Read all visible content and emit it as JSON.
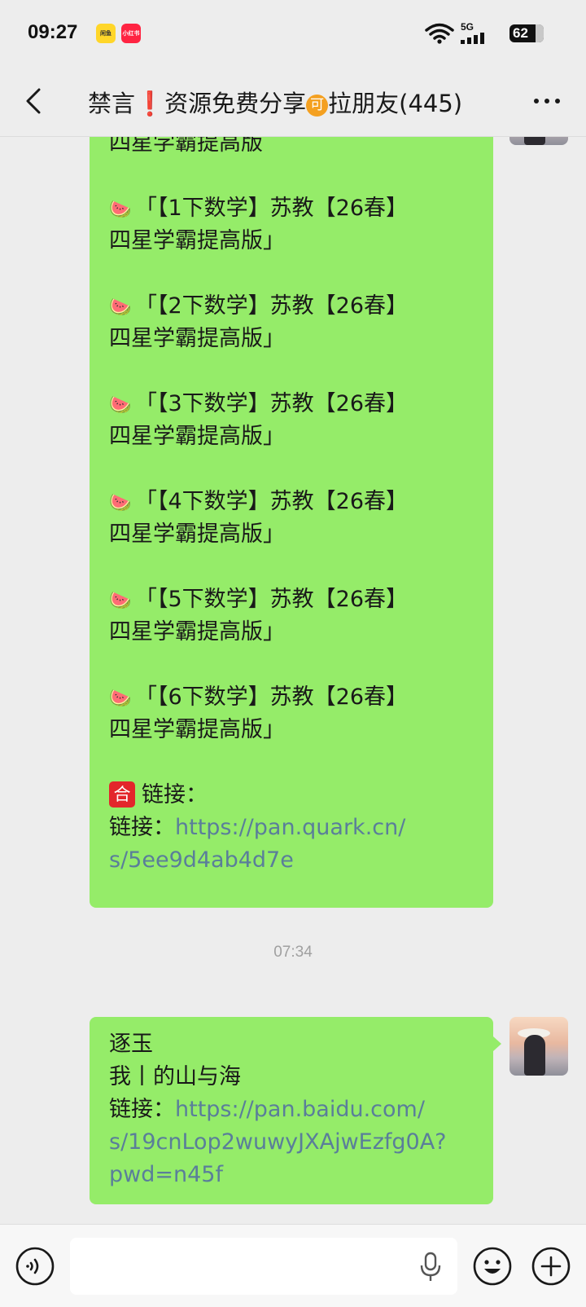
{
  "status_bar": {
    "time": "09:27",
    "app_icon_1": "闲鱼",
    "app_icon_2": "小红书",
    "network": "5G",
    "battery": "62"
  },
  "header": {
    "title_part1": "禁言",
    "title_excl": "❗",
    "title_part2": "资源免费分享",
    "title_badge": "可",
    "title_part3": "拉朋友(445)"
  },
  "messages": {
    "first": {
      "top_fragment": "四星学霸提高版",
      "items": [
        {
          "icon": "🍉",
          "line1": "「【1下数学】苏教【26春】",
          "line2": "四星学霸提高版」"
        },
        {
          "icon": "🍉",
          "line1": "「【2下数学】苏教【26春】",
          "line2": "四星学霸提高版」"
        },
        {
          "icon": "🍉",
          "line1": "「【3下数学】苏教【26春】",
          "line2": "四星学霸提高版」"
        },
        {
          "icon": "🍉",
          "line1": "「【4下数学】苏教【26春】",
          "line2": "四星学霸提高版」"
        },
        {
          "icon": "🍉",
          "line1": "「【5下数学】苏教【26春】",
          "line2": "四星学霸提高版」"
        },
        {
          "icon": "🍉",
          "line1": "「【6下数学】苏教【26春】",
          "line2": "四星学霸提高版」"
        }
      ],
      "link_heading_icon": "合",
      "link_heading": "链接：",
      "link_label": "链接：",
      "link_line1": "https://pan.quark.cn/",
      "link_line2": "s/5ee9d4ab4d7e"
    },
    "timestamp": "07:34",
    "second": {
      "line1": "逐玉",
      "line2": "我丨的山与海",
      "link_label": "链接：",
      "link_line1": "https://pan.baidu.com/",
      "link_line2": "s/19cnLop2wuwyJXAjwEzfg0A?",
      "link_line3": "pwd=n45f"
    }
  },
  "input": {
    "value": "",
    "placeholder": ""
  },
  "icons": {
    "back": "chevron-left-icon",
    "more": "more-dots-icon",
    "voice": "voice-icon",
    "mic": "microphone-icon",
    "emoji": "emoji-icon",
    "plus": "plus-icon"
  },
  "colors": {
    "bubble": "#95ec69",
    "link": "#5a7e9a",
    "background": "#ededed"
  }
}
